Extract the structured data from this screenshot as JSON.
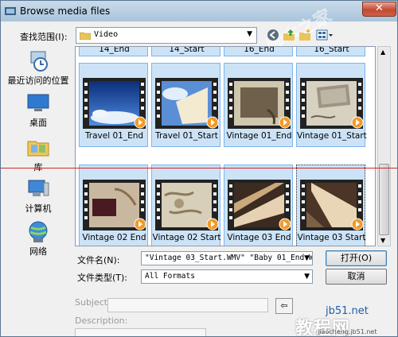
{
  "window": {
    "title": "Browse media files",
    "close_glyph": "✕"
  },
  "lookin": {
    "label": "查找范围(I):",
    "value": "Video"
  },
  "toolbar": {
    "icons": [
      "back-icon",
      "up-folder-icon",
      "new-folder-icon",
      "view-menu-icon"
    ]
  },
  "places": [
    {
      "label": "最近访问的位置",
      "icon": "recent-places-icon"
    },
    {
      "label": "桌面",
      "icon": "desktop-icon"
    },
    {
      "label": "库",
      "icon": "libraries-icon"
    },
    {
      "label": "计算机",
      "icon": "computer-icon"
    },
    {
      "label": "网络",
      "icon": "network-icon"
    }
  ],
  "files": {
    "row0": [
      "14_End",
      "14_Start",
      "16_End",
      "16_Start"
    ],
    "row1": [
      "Travel 01_End",
      "Travel 01_Start",
      "Vintage 01_End",
      "Vintage 01_Start"
    ],
    "row2": [
      "Vintage 02 End",
      "Vintage 02 Start",
      "Vintage 03 End",
      "Vintage 03 Start"
    ]
  },
  "filename": {
    "label": "文件名(N):",
    "value": "\"Vintage 03_Start.WMV\" \"Baby 01_End.W"
  },
  "filetype": {
    "label": "文件类型(T):",
    "value": "All Formats"
  },
  "buttons": {
    "open": "打开(O)",
    "cancel": "取消"
  },
  "meta": {
    "subject_label": "Subject:",
    "description_label": "Description:"
  },
  "watermark": {
    "site": "jb51.net",
    "brand": "教程网",
    "brand_prefix": "脚本之家",
    "url": "jiaocheng.jb51.net"
  },
  "colors": {
    "selection": "#cce3f7",
    "selection_border": "#7eb4ea",
    "guide_line": "#d3262b"
  }
}
